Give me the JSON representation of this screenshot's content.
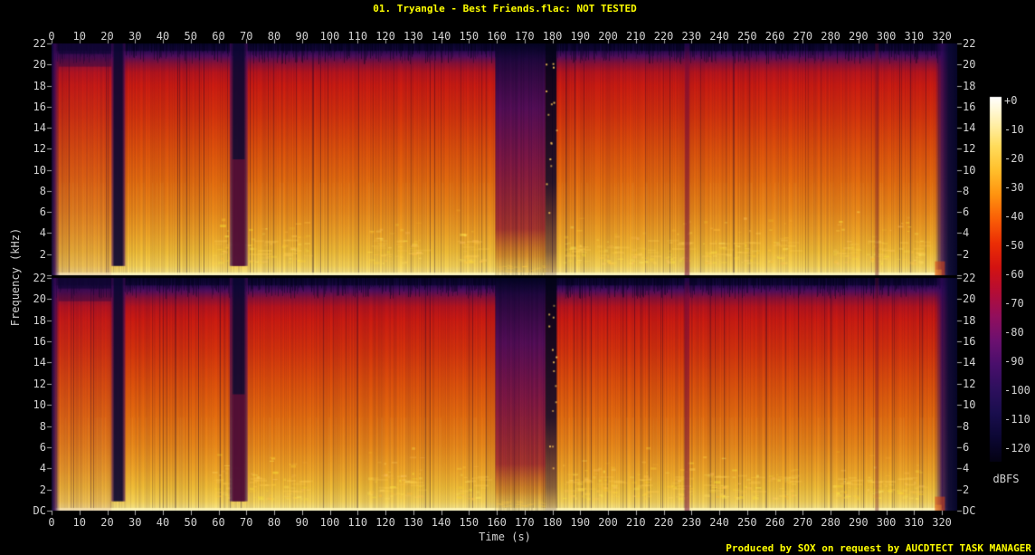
{
  "header": {
    "title": "01. Tryangle - Best Friends.flac: NOT TESTED"
  },
  "footer": {
    "credit": "Produced by SOX on request by AUCDTECT TASK MANAGER"
  },
  "chart_data": {
    "type": "heatmap",
    "variant": "audio-spectrogram",
    "title": "01. Tryangle - Best Friends.flac: NOT TESTED",
    "xlabel": "Time (s)",
    "ylabel": "Frequency (kHz)",
    "channels": 2,
    "x_range_s": [
      0,
      325.5
    ],
    "x_ticks_s": [
      0,
      10,
      20,
      30,
      40,
      50,
      60,
      70,
      80,
      90,
      100,
      110,
      120,
      130,
      140,
      150,
      160,
      170,
      180,
      190,
      200,
      210,
      220,
      230,
      240,
      250,
      260,
      270,
      280,
      290,
      300,
      310,
      320
    ],
    "y_range_khz": [
      0,
      22
    ],
    "y_ticks_khz": [
      "22",
      "20",
      "18",
      "16",
      "14",
      "12",
      "10",
      "8",
      "6",
      "4",
      "2",
      "DC"
    ],
    "legend": {
      "label": "dBFS",
      "ticks": [
        "+0",
        "-10",
        "-20",
        "-30",
        "-40",
        "-50",
        "-60",
        "-70",
        "-80",
        "-90",
        "-100",
        "-110",
        "-120"
      ],
      "range_db": [
        0,
        -120
      ]
    },
    "palette": [
      {
        "db": 0,
        "color": "#ffffff"
      },
      {
        "db": -4,
        "color": "#fff9d9"
      },
      {
        "db": -10,
        "color": "#ffed9e"
      },
      {
        "db": -16,
        "color": "#ffdd5e"
      },
      {
        "db": -24,
        "color": "#ffc02c"
      },
      {
        "db": -32,
        "color": "#ff9410"
      },
      {
        "db": -40,
        "color": "#fa6007"
      },
      {
        "db": -48,
        "color": "#ec2f05"
      },
      {
        "db": -56,
        "color": "#d41311"
      },
      {
        "db": -64,
        "color": "#b50d35"
      },
      {
        "db": -72,
        "color": "#930f5c"
      },
      {
        "db": -80,
        "color": "#6d1170"
      },
      {
        "db": -88,
        "color": "#4a0f6c"
      },
      {
        "db": -96,
        "color": "#2e105e"
      },
      {
        "db": -104,
        "color": "#1a0e4e"
      },
      {
        "db": -112,
        "color": "#0c0734"
      },
      {
        "db": -120,
        "color": "#040213"
      }
    ],
    "events": [
      {
        "kind": "fade-in",
        "t": [
          0,
          3
        ]
      },
      {
        "kind": "intro",
        "t": [
          2.5,
          21.5
        ]
      },
      {
        "kind": "break",
        "t": [
          21.5,
          26.5
        ]
      },
      {
        "kind": "break",
        "t": [
          64,
          70.5
        ]
      },
      {
        "kind": "quiet-section",
        "t": [
          159.5,
          177.5
        ]
      },
      {
        "kind": "very-quiet",
        "t": [
          177.5,
          181.5
        ]
      },
      {
        "kind": "thin-break",
        "t": [
          227.5,
          229.3
        ]
      },
      {
        "kind": "thin-faint",
        "t": [
          296,
          297.3
        ]
      },
      {
        "kind": "fade-out",
        "t": [
          317.5,
          325.5
        ]
      }
    ],
    "texture": {
      "lowpass_shelf_khz": 21,
      "bass_band_khz": [
        0,
        1.5
      ],
      "speckle_clusters_s": [
        62,
        75,
        87,
        118,
        128,
        150,
        188,
        199,
        212,
        225,
        238,
        249,
        262,
        285,
        297,
        308
      ]
    },
    "colors": {
      "title_text": "#ffff00",
      "tick_text": "#d2d2d2",
      "tick_mark": "#a8a8a8",
      "background": "#000000"
    }
  }
}
